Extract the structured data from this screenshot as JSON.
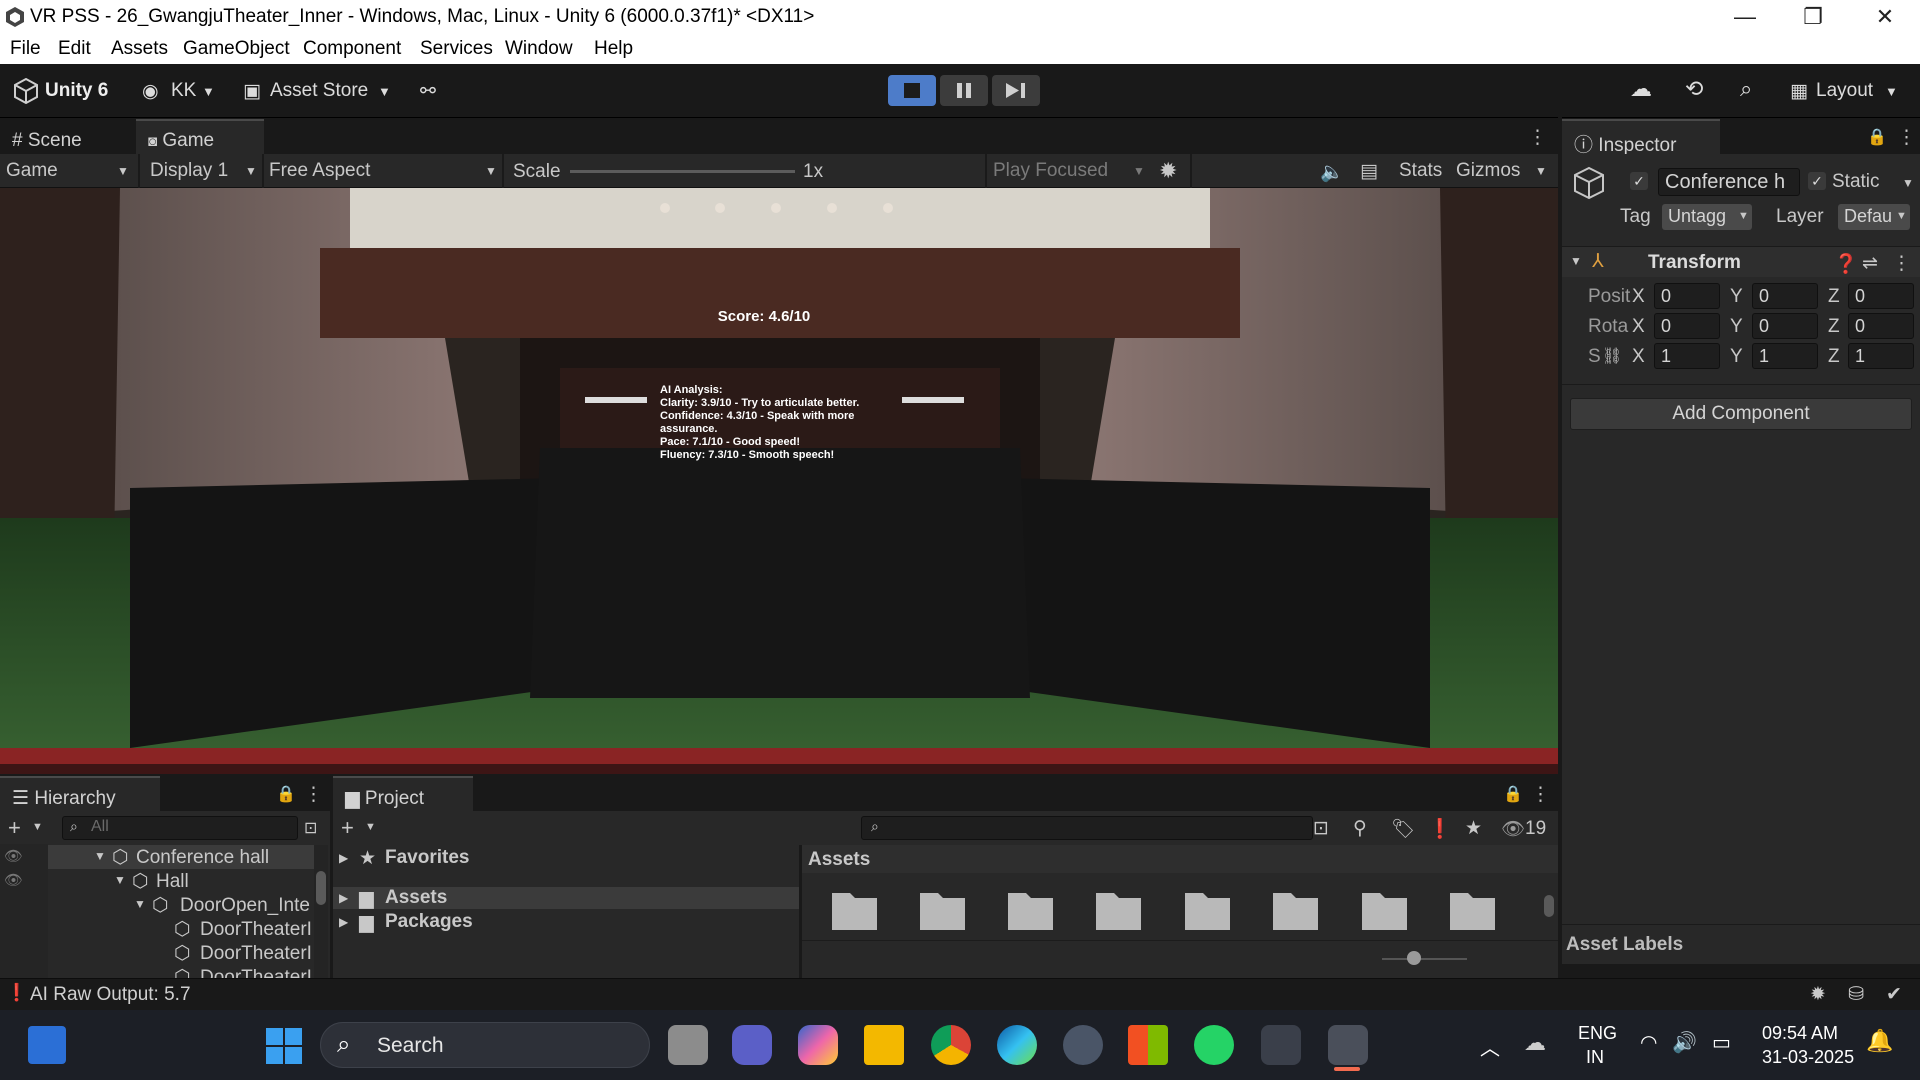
{
  "window": {
    "title": "VR PSS - 26_GwangjuTheater_Inner - Windows, Mac, Linux - Unity 6 (6000.0.37f1)* <DX11>",
    "minimize": "—",
    "maximize": "❐",
    "close": "✕"
  },
  "menu": [
    "File",
    "Edit",
    "Assets",
    "GameObject",
    "Component",
    "Services",
    "Window",
    "Help"
  ],
  "toolbar": {
    "unity_label": "Unity 6",
    "account": "KK",
    "asset_store": "Asset Store",
    "layout": "Layout"
  },
  "game_view": {
    "tabs": [
      "Scene",
      "Game"
    ],
    "active_tab": "Game",
    "view_mode": "Game",
    "display": "Display 1",
    "aspect": "Free Aspect",
    "scale_label": "Scale",
    "scale_value": "1x",
    "play_mode": "Play Focused",
    "stats": "Stats",
    "gizmos": "Gizmos",
    "score": "Score:  4.6/10",
    "analysis_title": "AI Analysis:",
    "analysis_lines": [
      "Clarity: 3.9/10 - Try to articulate better.",
      "Confidence: 4.3/10 - Speak with more",
      "assurance.",
      "Pace: 7.1/10 - Good speed!",
      "Fluency: 7.3/10 - Smooth speech!"
    ]
  },
  "inspector": {
    "tab": "Inspector",
    "object_name": "Conference h",
    "static_label": "Static",
    "tag_label": "Tag",
    "tag_value": "Untagg",
    "layer_label": "Layer",
    "layer_value": "Defau",
    "component": "Transform",
    "rows": [
      {
        "label": "Posit",
        "x": "0",
        "y": "0",
        "z": "0"
      },
      {
        "label": "Rota",
        "x": "0",
        "y": "0",
        "z": "0"
      },
      {
        "label": "S",
        "x": "1",
        "y": "1",
        "z": "1"
      }
    ],
    "axis_x": "X",
    "axis_y": "Y",
    "axis_z": "Z",
    "add_component": "Add Component",
    "asset_labels": "Asset Labels"
  },
  "hierarchy": {
    "tab": "Hierarchy",
    "search_placeholder": "All",
    "items": [
      {
        "label": "Conference hall",
        "indent": 0
      },
      {
        "label": "Hall",
        "indent": 1
      },
      {
        "label": "DoorOpen_Inte",
        "indent": 2
      },
      {
        "label": "DoorTheaterI",
        "indent": 3
      },
      {
        "label": "DoorTheaterI",
        "indent": 3
      },
      {
        "label": "DoorTheaterI",
        "indent": 3
      }
    ]
  },
  "project": {
    "tab": "Project",
    "favorites": "Favorites",
    "assets": "Assets",
    "packages": "Packages",
    "breadcrumb": "Assets",
    "hidden_count": "19",
    "folder_count": 8
  },
  "status": {
    "message": "AI Raw Output: 5.7"
  },
  "taskbar": {
    "search": "Search",
    "lang_top": "ENG",
    "lang_bottom": "IN",
    "time": "09:54 AM",
    "date": "31-03-2025"
  },
  "colors": {
    "accent": "#4d7cc9",
    "panel": "#282828",
    "toolbar": "#191919"
  }
}
